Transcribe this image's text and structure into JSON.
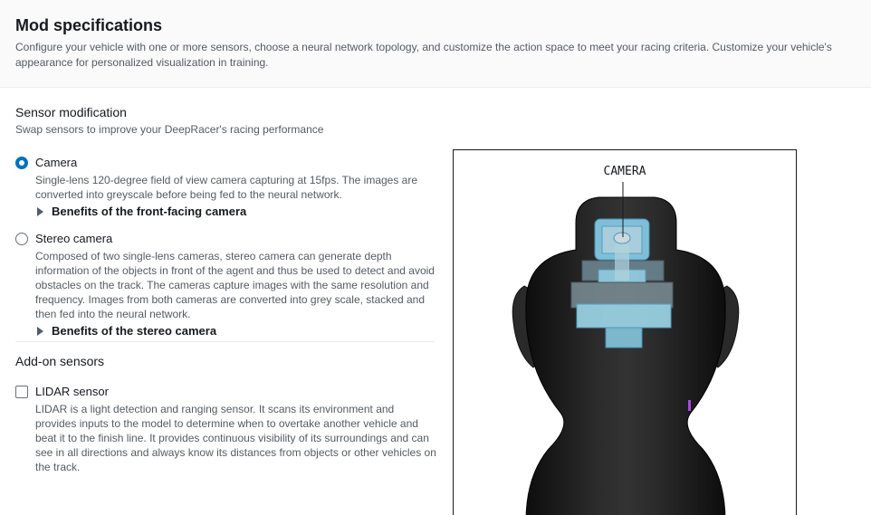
{
  "header": {
    "title": "Mod specifications",
    "description": "Configure your vehicle with one or more sensors, choose a neural network topology, and customize the action space to meet your racing criteria. Customize your vehicle's appearance for personalized visualization in training."
  },
  "sensor_modification": {
    "title": "Sensor modification",
    "description": "Swap sensors to improve your DeepRacer's racing performance",
    "options": [
      {
        "label": "Camera",
        "selected": true,
        "description": "Single-lens 120-degree field of view camera capturing at 15fps. The images are converted into greyscale before being fed to the neural network.",
        "expander_label": "Benefits of the front-facing camera"
      },
      {
        "label": "Stereo camera",
        "selected": false,
        "description": "Composed of two single-lens cameras, stereo camera can generate depth information of the objects in front of the agent and thus be used to detect and avoid obstacles on the track. The cameras capture images with the same resolution and frequency. Images from both cameras are converted into grey scale, stacked and then fed into the neural network.",
        "expander_label": "Benefits of the stereo camera"
      }
    ]
  },
  "addon_sensors": {
    "title": "Add-on sensors",
    "options": [
      {
        "label": "LIDAR sensor",
        "checked": false,
        "description": "LIDAR is a light detection and ranging sensor. It scans its environment and provides inputs to the model to determine when to overtake another vehicle and beat it to the finish line. It provides continuous visibility of its surroundings and can see in all directions and always know its distances from objects or other vehicles on the track."
      }
    ]
  },
  "visualization": {
    "label": "CAMERA"
  },
  "colors": {
    "accent": "#0073bb",
    "camera_highlight": "#7fd3f0",
    "car_body": "#1a1a1a"
  }
}
